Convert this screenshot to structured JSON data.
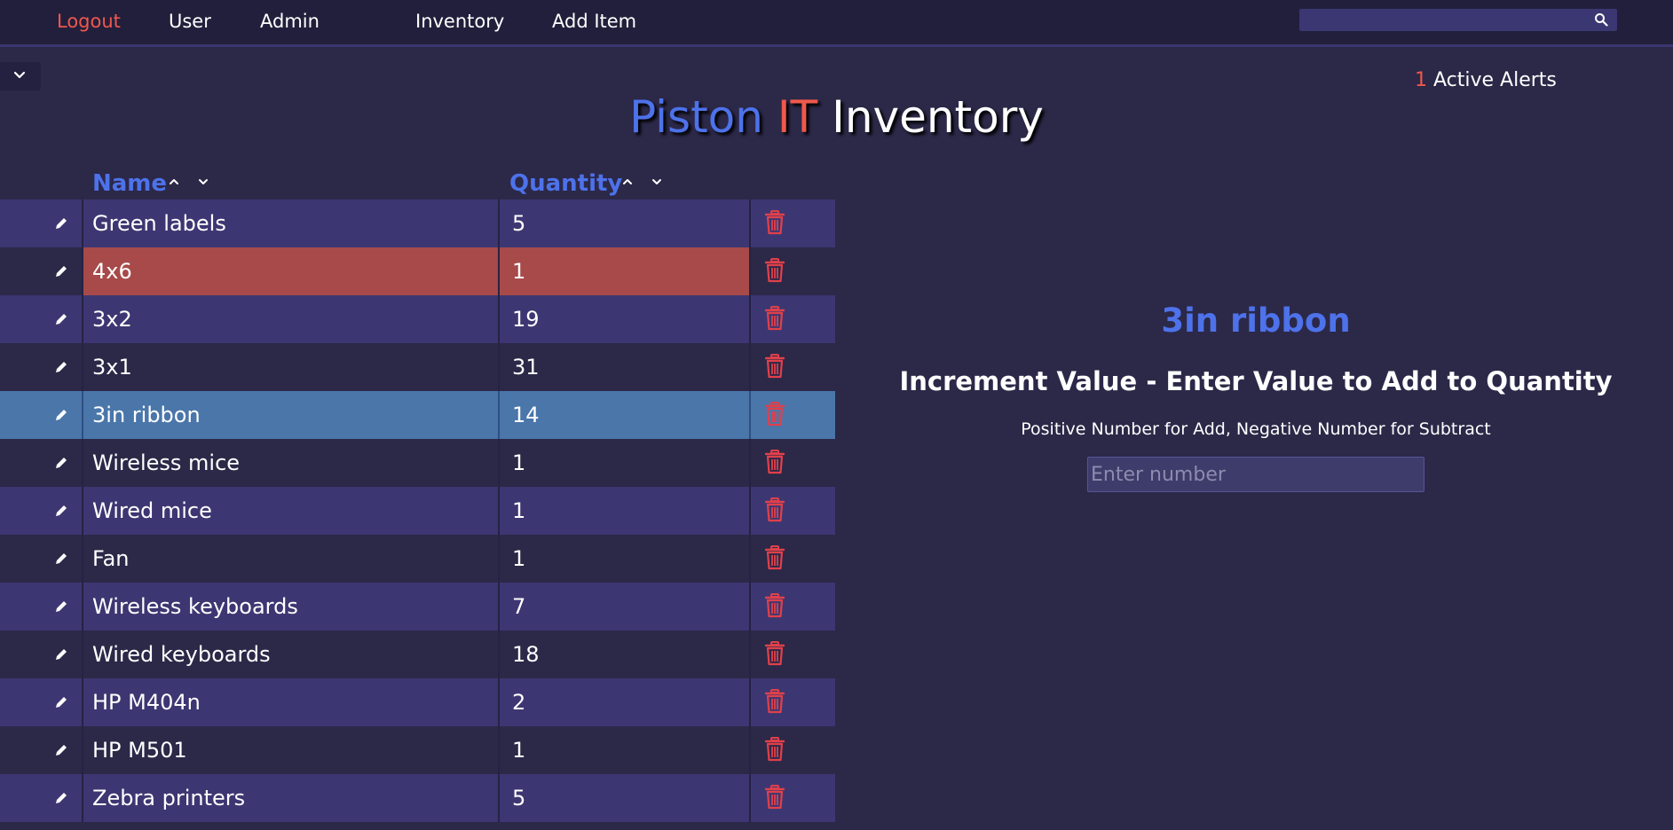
{
  "nav": {
    "logout": "Logout",
    "user": "User",
    "admin": "Admin",
    "inventory": "Inventory",
    "add_item": "Add Item",
    "search_placeholder": ""
  },
  "alerts": {
    "count": "1",
    "label": " Active Alerts"
  },
  "title": {
    "part1": "Piston",
    "part2": "IT",
    "part3": "Inventory"
  },
  "table": {
    "headers": {
      "name": "Name",
      "quantity": "Quantity"
    },
    "rows": [
      {
        "name": "Green labels",
        "quantity": "5"
      },
      {
        "name": "4x6",
        "quantity": "1"
      },
      {
        "name": "3x2",
        "quantity": "19"
      },
      {
        "name": "3x1",
        "quantity": "31"
      },
      {
        "name": "3in ribbon",
        "quantity": "14"
      },
      {
        "name": "Wireless mice",
        "quantity": "1"
      },
      {
        "name": "Wired mice",
        "quantity": "1"
      },
      {
        "name": "Fan",
        "quantity": "1"
      },
      {
        "name": "Wireless keyboards",
        "quantity": "7"
      },
      {
        "name": "Wired keyboards",
        "quantity": "18"
      },
      {
        "name": "HP M404n",
        "quantity": "2"
      },
      {
        "name": "HP M501",
        "quantity": "1"
      },
      {
        "name": "Zebra printers",
        "quantity": "5"
      }
    ]
  },
  "panel": {
    "selected_name": "3in ribbon",
    "heading": "Increment Value - Enter Value to Add to Quantity",
    "hint": "Positive Number for Add, Negative Number for Subtract",
    "input_placeholder": "Enter number"
  },
  "colors": {
    "background": "#2c2848",
    "accent_blue": "#4d72ea",
    "alert_red": "#f0584c",
    "alert_row": "#a84a4a",
    "selected_row": "#4a76aa",
    "odd_row": "#3c3772"
  }
}
